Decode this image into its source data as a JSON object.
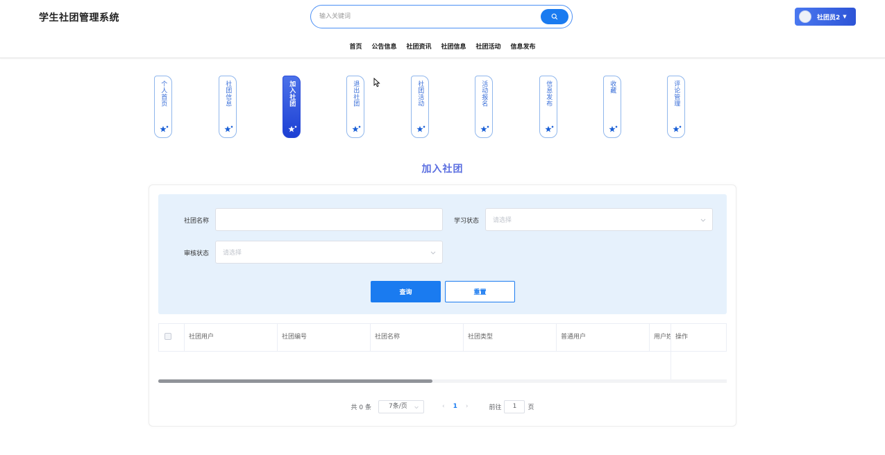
{
  "header": {
    "logo": "学生社团管理系统",
    "search_placeholder": "输入关键词",
    "user_name": "社团员2",
    "nav": [
      "首页",
      "公告信息",
      "社团资讯",
      "社团信息",
      "社团活动",
      "信息发布"
    ]
  },
  "side_tabs": [
    {
      "label": "个人首页",
      "active": false
    },
    {
      "label": "社团信息",
      "active": false
    },
    {
      "label": "加入社团",
      "active": true
    },
    {
      "label": "退出社团",
      "active": false
    },
    {
      "label": "社团活动",
      "active": false
    },
    {
      "label": "活动报名",
      "active": false
    },
    {
      "label": "信息发布",
      "active": false
    },
    {
      "label": "收藏",
      "active": false
    },
    {
      "label": "评论管理",
      "active": false
    }
  ],
  "page_title": "加入社团",
  "filter": {
    "club_name_label": "社团名称",
    "club_name_value": "",
    "study_status_label": "学习状态",
    "study_status_placeholder": "请选择",
    "audit_status_label": "审核状态",
    "audit_status_placeholder": "请选择",
    "query_button": "查询",
    "reset_button": "重置"
  },
  "table": {
    "columns": [
      "社团用户",
      "社团编号",
      "社团名称",
      "社团类型",
      "普通用户",
      "用户姓",
      "操作"
    ]
  },
  "pagination": {
    "total": "共 0 条",
    "page_size": "7条/页",
    "current_page": "1",
    "goto_label": "前往",
    "goto_value": "1",
    "page_unit": "页",
    "prev": "‹",
    "next": "›"
  },
  "colors": {
    "primary": "#1a7bf0",
    "filter_bg": "#e6f1fc",
    "active_tab": "#2a4bd8",
    "title": "#5a6ee0"
  }
}
